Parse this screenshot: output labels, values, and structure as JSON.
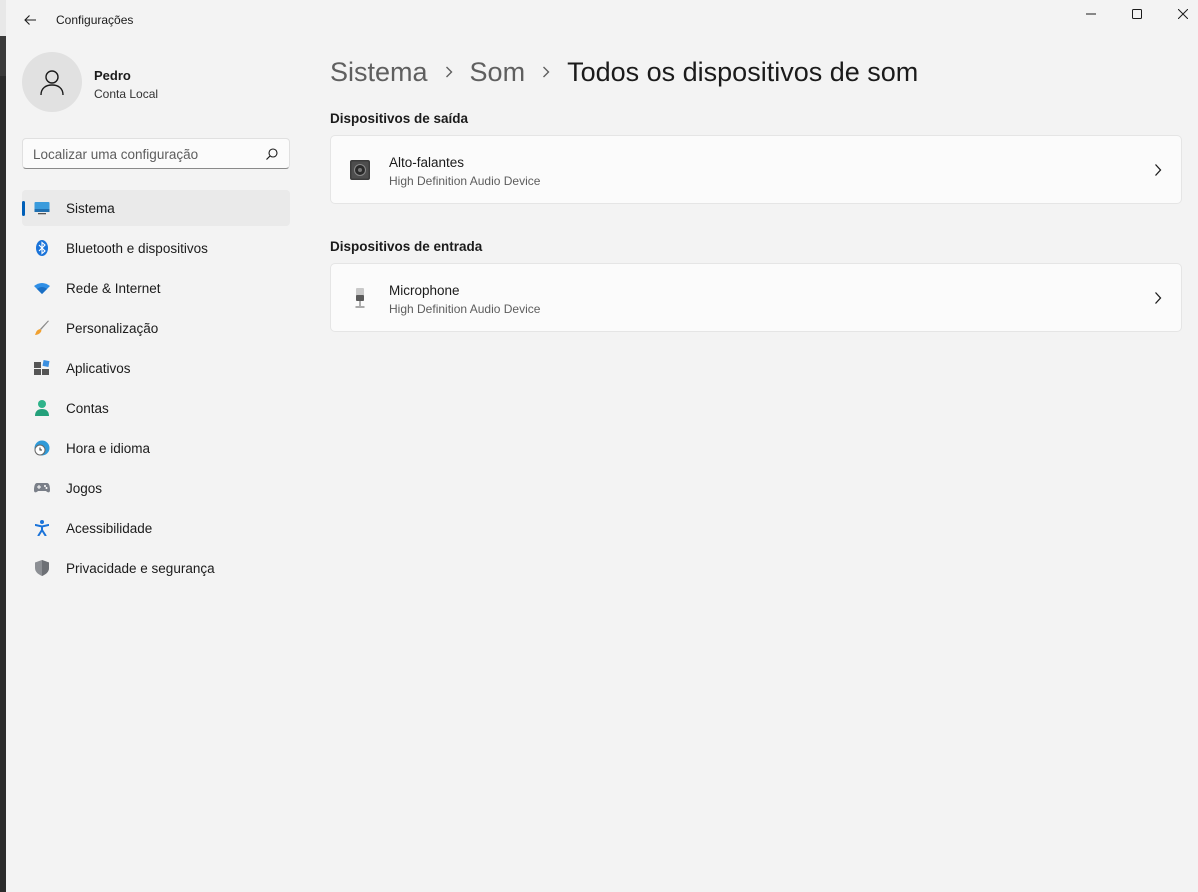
{
  "window": {
    "app_title": "Configurações"
  },
  "profile": {
    "name": "Pedro",
    "account_type": "Conta Local"
  },
  "search": {
    "placeholder": "Localizar uma configuração"
  },
  "sidebar": {
    "items": [
      {
        "label": "Sistema",
        "icon": "system-icon",
        "active": true
      },
      {
        "label": "Bluetooth e dispositivos",
        "icon": "bluetooth-icon"
      },
      {
        "label": "Rede & Internet",
        "icon": "wifi-icon"
      },
      {
        "label": "Personalização",
        "icon": "brush-icon"
      },
      {
        "label": "Aplicativos",
        "icon": "apps-icon"
      },
      {
        "label": "Contas",
        "icon": "person-icon"
      },
      {
        "label": "Hora e idioma",
        "icon": "clock-globe-icon"
      },
      {
        "label": "Jogos",
        "icon": "gamepad-icon"
      },
      {
        "label": "Acessibilidade",
        "icon": "accessibility-icon"
      },
      {
        "label": "Privacidade e segurança",
        "icon": "shield-icon"
      }
    ]
  },
  "breadcrumb": {
    "items": [
      "Sistema",
      "Som"
    ],
    "current": "Todos os dispositivos de som"
  },
  "output_section": {
    "title": "Dispositivos de saída",
    "devices": [
      {
        "name": "Alto-falantes",
        "description": "High Definition Audio Device",
        "icon": "speaker-icon"
      }
    ]
  },
  "input_section": {
    "title": "Dispositivos de entrada",
    "devices": [
      {
        "name": "Microphone",
        "description": "High Definition Audio Device",
        "icon": "microphone-icon"
      }
    ]
  },
  "colors": {
    "accent": "#005fb8",
    "background": "#f3f3f3",
    "card": "#fbfbfb"
  }
}
